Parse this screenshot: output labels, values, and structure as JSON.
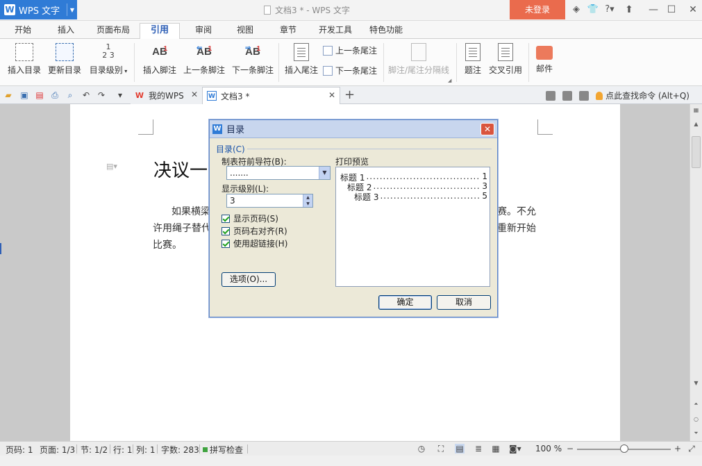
{
  "app": {
    "name": "WPS 文字",
    "window_title": "文档3 * - WPS 文字",
    "login_label": "未登录"
  },
  "menu": {
    "tabs": [
      "开始",
      "插入",
      "页面布局",
      "引用",
      "审阅",
      "视图",
      "章节",
      "开发工具",
      "特色功能"
    ],
    "active": "引用"
  },
  "ribbon": {
    "insert_toc": "插入目录",
    "update_toc": "更新目录",
    "toc_level": "目录级别",
    "insert_footnote": "插入脚注",
    "prev_footnote": "上一条脚注",
    "next_footnote": "下一条脚注",
    "insert_endnote": "插入尾注",
    "prev_endnote": "上一条尾注",
    "next_endnote": "下一条尾注",
    "separator_line": "脚注/尾注分隔线",
    "caption": "题注",
    "cross_ref": "交叉引用",
    "mail": "邮件"
  },
  "tabs_bar": {
    "mywps_label": "我的WPS",
    "doc_label": "文档3 *",
    "search_label": "点此查找命令 (Alt+Q)"
  },
  "document": {
    "heading": "决议一",
    "line1_left": "如果横梁",
    "line1_right": "赛。不允",
    "line2_left": "许用绳子替代",
    "line2_right": "重新开始",
    "line3": "比赛。"
  },
  "dialog": {
    "title": "目录",
    "group_label": "目录(C)",
    "tab_leader_label": "制表符前导符(B):",
    "tab_leader_value": ".......",
    "show_levels_label": "显示级别(L):",
    "show_levels_value": "3",
    "options": [
      {
        "label": "显示页码(S)",
        "checked": true
      },
      {
        "label": "页码右对齐(R)",
        "checked": true
      },
      {
        "label": "使用超链接(H)",
        "checked": true
      }
    ],
    "options_button": "选项(O)...",
    "preview_label": "打印预览",
    "preview_rows": [
      {
        "title": "标题 1",
        "page": "1"
      },
      {
        "title": "标题 2",
        "page": "3"
      },
      {
        "title": "标题 3",
        "page": "5"
      }
    ],
    "ok_label": "确定",
    "cancel_label": "取消"
  },
  "status": {
    "page_code": "页码: 1",
    "pages": "页面: 1/3",
    "section": "节: 1/2",
    "line": "行: 1",
    "column": "列: 1",
    "word_count": "字数: 283",
    "spell_check": "拼写检查",
    "zoom": "100 %"
  },
  "colors": {
    "brand_blue": "#2f7bd6",
    "login_orange": "#ea6b4d",
    "dialog_bg": "#ece9d8"
  }
}
